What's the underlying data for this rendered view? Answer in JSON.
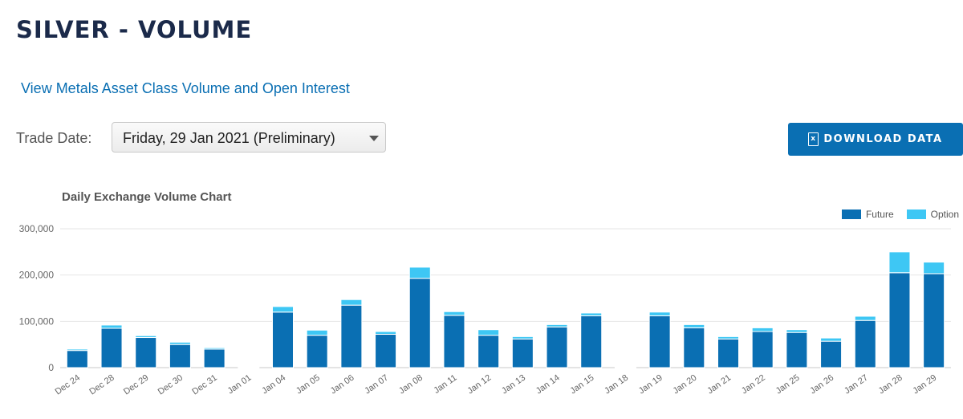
{
  "header": {
    "title": "SILVER - VOLUME"
  },
  "links": {
    "asset_class": "View Metals Asset Class Volume and Open Interest"
  },
  "controls": {
    "trade_date_label": "Trade Date:",
    "trade_date_value": "Friday, 29 Jan 2021 (Preliminary)",
    "download_label": "DOWNLOAD DATA",
    "download_icon": "excel-file-icon"
  },
  "chart_data": {
    "type": "bar",
    "stacked": true,
    "title": "Daily Exchange Volume Chart",
    "categories": [
      "Dec 24",
      "Dec 28",
      "Dec 29",
      "Dec 30",
      "Dec 31",
      "Jan 01",
      "Jan 04",
      "Jan 05",
      "Jan 06",
      "Jan 07",
      "Jan 08",
      "Jan 11",
      "Jan 12",
      "Jan 13",
      "Jan 14",
      "Jan 15",
      "Jan 18",
      "Jan 19",
      "Jan 20",
      "Jan 21",
      "Jan 22",
      "Jan 25",
      "Jan 26",
      "Jan 27",
      "Jan 28",
      "Jan 29"
    ],
    "series": [
      {
        "name": "Future",
        "color": "#0a6fb3",
        "values": [
          37000,
          85000,
          65000,
          50000,
          40000,
          500,
          120000,
          70000,
          135000,
          72000,
          193000,
          113000,
          70000,
          62000,
          88000,
          112000,
          500,
          112000,
          86000,
          62000,
          78000,
          76000,
          57000,
          102000,
          205000,
          203000
        ]
      },
      {
        "name": "Option",
        "color": "#3ec7f4",
        "values": [
          3000,
          7000,
          4000,
          5000,
          3000,
          0,
          12000,
          11000,
          12000,
          6000,
          24000,
          8000,
          12000,
          5000,
          5000,
          6000,
          0,
          8000,
          7000,
          5000,
          8000,
          6000,
          7000,
          9000,
          45000,
          25000
        ]
      }
    ],
    "yticks": [
      "0",
      "100,000",
      "200,000",
      "300,000"
    ],
    "ytick_values": [
      0,
      100000,
      200000,
      300000
    ],
    "ylim": [
      0,
      300000
    ],
    "legend_position": "top-right",
    "grid": true
  }
}
